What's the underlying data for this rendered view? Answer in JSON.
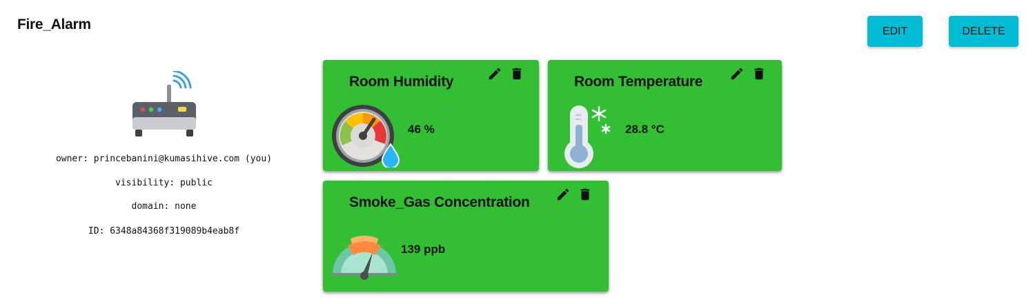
{
  "device": {
    "name": "Fire_Alarm",
    "icon": "router-icon",
    "owner": "owner: princebanini@kumasihive.com (you)",
    "visibility": "visibility: public",
    "domain": "domain: none",
    "id": "ID: 6348a84368f319089b4eab8f"
  },
  "actions": {
    "edit_label": "EDIT",
    "delete_label": "DELETE",
    "accent_color": "#00bcd4"
  },
  "widgets": [
    {
      "title": "Room Humidity",
      "value": "46 %",
      "icon": "humidity-gauge-icon",
      "color": "#33bf33"
    },
    {
      "title": "Room Temperature",
      "value": "28.8 °C",
      "icon": "thermometer-icon",
      "color": "#33bf33"
    },
    {
      "title": "Smoke_Gas Concentration",
      "value": "139 ppb",
      "icon": "gas-gauge-icon",
      "color": "#33bf33"
    }
  ]
}
